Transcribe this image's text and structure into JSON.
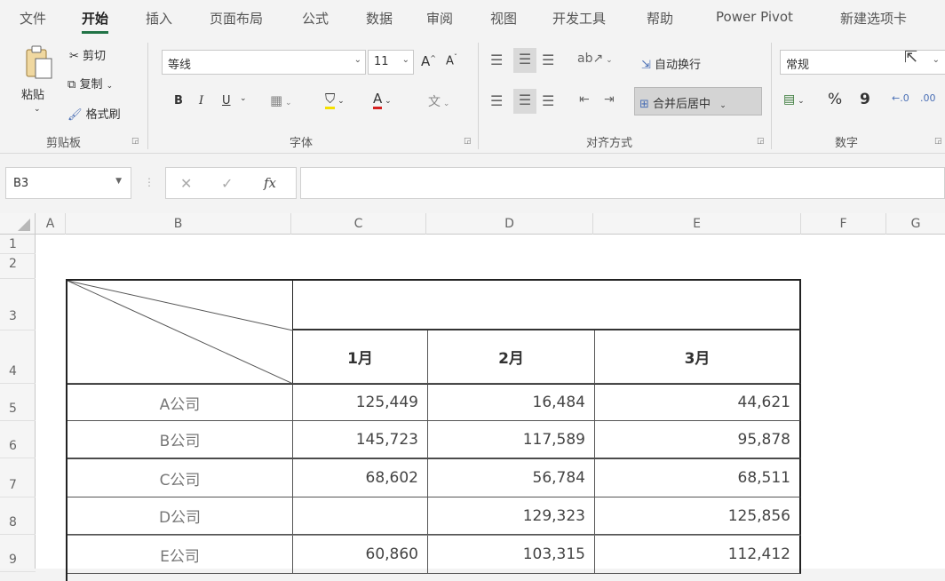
{
  "ribbon_tabs": [
    "文件",
    "开始",
    "插入",
    "页面布局",
    "公式",
    "数据",
    "审阅",
    "视图",
    "开发工具",
    "帮助",
    "Power Pivot",
    "新建选项卡"
  ],
  "active_tab": "开始",
  "clipboard": {
    "paste": "粘贴",
    "cut": "剪切",
    "copy": "复制",
    "format_painter": "格式刷",
    "group_label": "剪贴板"
  },
  "font": {
    "name": "等线",
    "size": "11",
    "bold": "B",
    "italic": "I",
    "underline": "U",
    "group_label": "字体"
  },
  "alignment": {
    "wrap_text": "自动换行",
    "merge_center": "合并后居中",
    "group_label": "对齐方式"
  },
  "number": {
    "format": "常规",
    "percent": "%",
    "comma": "9",
    "group_label": "数字"
  },
  "formula_bar": {
    "name_box": "B3",
    "fx": "fx",
    "formula": ""
  },
  "columns": [
    "A",
    "B",
    "C",
    "D",
    "E",
    "F",
    "G"
  ],
  "rows": [
    "1",
    "2",
    "3",
    "4",
    "5",
    "6",
    "7",
    "8",
    "9"
  ],
  "table": {
    "months": [
      "1月",
      "2月",
      "3月"
    ],
    "companies": [
      {
        "name": "A公司",
        "values": [
          "125,449",
          "16,484",
          "44,621"
        ]
      },
      {
        "name": "B公司",
        "values": [
          "145,723",
          "117,589",
          "95,878"
        ]
      },
      {
        "name": "C公司",
        "values": [
          "68,602",
          "56,784",
          "68,511"
        ]
      },
      {
        "name": "D公司",
        "values": [
          "",
          "129,323",
          "125,856"
        ]
      },
      {
        "name": "E公司",
        "values": [
          "60,860",
          "103,315",
          "112,412"
        ]
      }
    ]
  }
}
